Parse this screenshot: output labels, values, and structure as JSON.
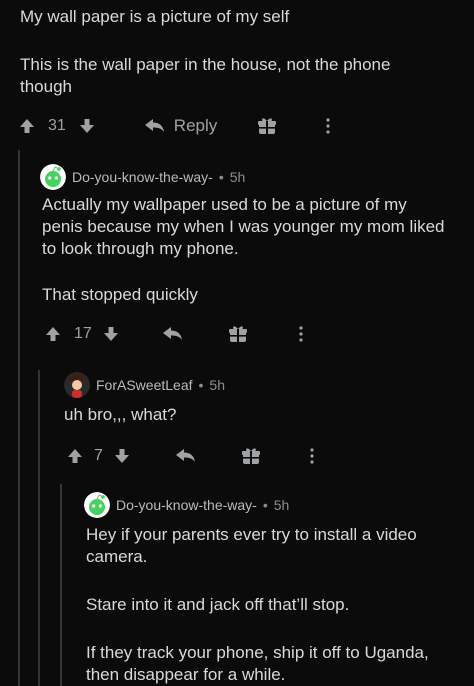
{
  "top_comment": {
    "lines": [
      "My wall paper is a picture of my self",
      "This is the wall paper in the house, not the phone though"
    ],
    "votes": "31",
    "reply_label": "Reply"
  },
  "reply1": {
    "author": "Do-you-know-the-way-",
    "separator": "•",
    "age": "5h",
    "body": "Actually my wallpaper used to be a picture of my penis because my when I was younger my mom liked to look through my phone.",
    "body2": "That stopped quickly",
    "votes": "17"
  },
  "reply2": {
    "author": "ForASweetLeaf",
    "separator": "•",
    "age": "5h",
    "body": "uh bro,,, what?",
    "votes": "7"
  },
  "reply3": {
    "author": "Do-you-know-the-way-",
    "separator": "•",
    "age": "5h",
    "body": "Hey if your parents ever try to install a video camera.",
    "body2": "Stare into it and jack off that’ll stop.",
    "body3": "If they track your phone, ship it off to Uganda, then disappear for a while."
  },
  "icons": {
    "upvote": "upvote-arrow-icon",
    "downvote": "downvote-arrow-icon",
    "reply": "reply-arrow-icon",
    "award": "gift-award-icon",
    "more": "more-vertical-icon",
    "snoo": "snoo-avatar-icon"
  },
  "colors": {
    "background": "#0b0b0b",
    "text": "#d7dadc",
    "muted": "#8c8f91",
    "thread": "#343536"
  }
}
